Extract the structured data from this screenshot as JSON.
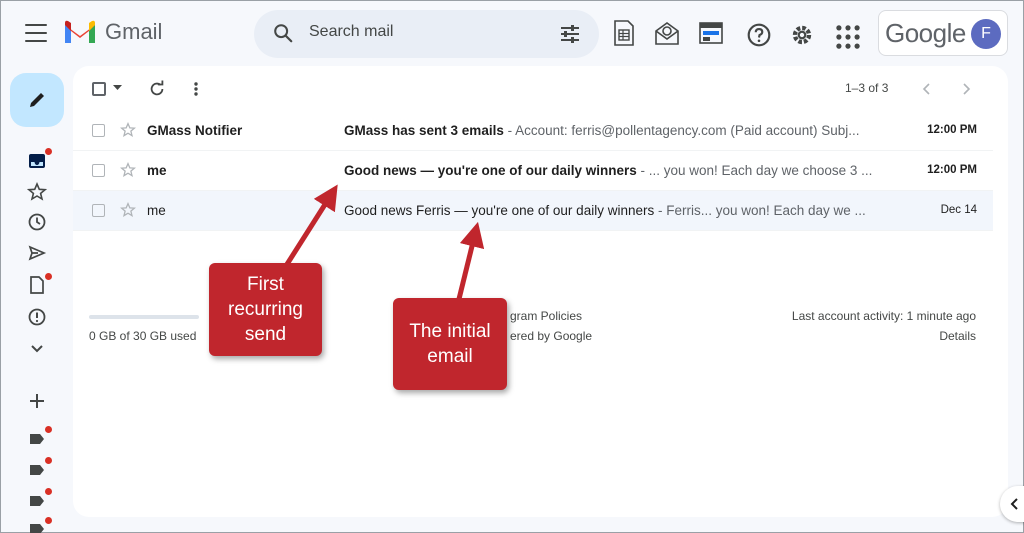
{
  "header": {
    "app_name": "Gmail",
    "search_placeholder": "Search mail",
    "account_brand": "Google",
    "avatar_initial": "F"
  },
  "toolbar": {
    "range": "1–3 of 3"
  },
  "emails": [
    {
      "sender": "GMass Notifier",
      "subject": "GMass has sent 3 emails",
      "snippet": " - Account: ferris@pollentagency.com (Paid account) Subj...",
      "time": "12:00 PM",
      "unread": true
    },
    {
      "sender": "me",
      "subject": "Good news — you're one of our daily winners",
      "snippet": " - ... you won! Each day we choose 3 ...",
      "time": "12:00 PM",
      "unread": true
    },
    {
      "sender": "me",
      "subject": "Good news Ferris — you're one of our daily winners",
      "snippet": " - Ferris... you won! Each day we ...",
      "time": "Dec 14",
      "unread": false
    }
  ],
  "footer": {
    "storage": "0 GB of 30 GB used",
    "policies": "gram Policies",
    "powered": "ered by Google",
    "activity": "Last account activity: 1 minute ago",
    "details": "Details"
  },
  "annotations": {
    "first_recurring": "First recurring send",
    "initial_email": "The initial email"
  },
  "colors": {
    "callout": "#c0262d",
    "compose_bg": "#c2e7ff",
    "avatar": "#5c6bc0"
  }
}
